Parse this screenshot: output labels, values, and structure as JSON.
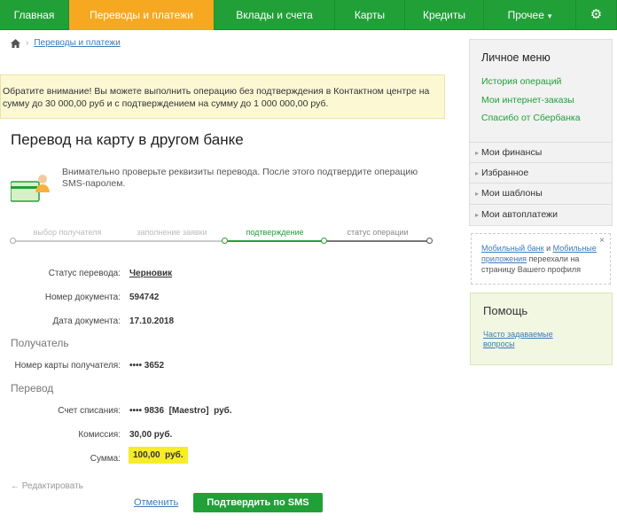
{
  "nav": {
    "items": [
      {
        "label": "Главная"
      },
      {
        "label": "Переводы и платежи"
      },
      {
        "label": "Вклады и счета"
      },
      {
        "label": "Карты"
      },
      {
        "label": "Кредиты"
      },
      {
        "label": "Прочее"
      }
    ],
    "active_index": 1,
    "more_icon": "chevron-down-icon",
    "settings_icon": "gear-icon"
  },
  "breadcrumb": {
    "home_icon": "home-icon",
    "link": "Переводы и платежи"
  },
  "notice": "Обратите внимание! Вы можете выполнить операцию без подтверждения в Контактном центре на сумму до 30 000,00 руб и с подтверждением на сумму до 1 000 000,00 руб.",
  "page_title": "Перевод на карту в другом банке",
  "intro": {
    "icon": "card-user-icon",
    "text": "Внимательно проверьте реквизиты перевода. После этого подтвердите операцию SMS-паролем."
  },
  "stepper": {
    "steps": [
      "выбор получателя",
      "заполнение заявки",
      "подтверждение",
      "статус операции"
    ],
    "current_index": 2
  },
  "details": {
    "status_label": "Статус перевода:",
    "status_value": "Черновик",
    "doc_number_label": "Номер документа:",
    "doc_number_value": "594742",
    "doc_date_label": "Дата документа:",
    "doc_date_value": "17.10.2018"
  },
  "recipient": {
    "heading": "Получатель",
    "card_label": "Номер карты получателя:",
    "card_value": "•••• 3652"
  },
  "transfer": {
    "heading": "Перевод",
    "account_label": "Счет списания:",
    "account_value": "•••• 9836  [Maestro]  руб.",
    "fee_label": "Комиссия:",
    "fee_value": "30,00 руб.",
    "amount_label": "Сумма:",
    "amount_value": "100,00  руб."
  },
  "actions": {
    "edit": "← Редактировать",
    "cancel": "Отменить",
    "confirm": "Подтвердить по SMS"
  },
  "sidebar": {
    "title": "Личное меню",
    "links": [
      "История операций",
      "Мои интернет-заказы",
      "Спасибо от Сбербанка"
    ],
    "rows": [
      "Мои финансы",
      "Избранное",
      "Мои шаблоны",
      "Мои автоплатежи"
    ]
  },
  "promo": {
    "link1": "Мобильный банк",
    "and": " и ",
    "link2": "Мобильные приложения",
    "rest": " переехали на страницу Вашего профиля",
    "close": "×"
  },
  "help": {
    "title": "Помощь",
    "link": "Часто задаваемые вопросы"
  },
  "colors": {
    "brand_green": "#21a038",
    "active_tab": "#f6a821",
    "notice_bg": "#fdf8d4",
    "amount_highlight": "#f7ec28",
    "link_blue": "#3d7ab8"
  }
}
